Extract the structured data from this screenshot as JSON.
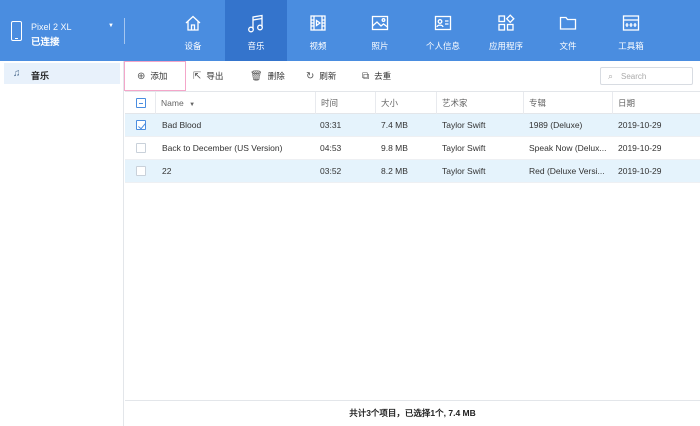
{
  "device": {
    "name": "Pixel 2 XL",
    "status": "已连接"
  },
  "nav": [
    {
      "id": "device",
      "label": "设备",
      "icon": "home-icon"
    },
    {
      "id": "music",
      "label": "音乐",
      "icon": "music-note-icon"
    },
    {
      "id": "video",
      "label": "视频",
      "icon": "film-icon"
    },
    {
      "id": "photos",
      "label": "照片",
      "icon": "image-icon"
    },
    {
      "id": "contacts",
      "label": "个人信息",
      "icon": "contact-card-icon"
    },
    {
      "id": "apps",
      "label": "应用程序",
      "icon": "apps-grid-icon"
    },
    {
      "id": "files",
      "label": "文件",
      "icon": "folder-icon"
    },
    {
      "id": "toolbox",
      "label": "工具箱",
      "icon": "toolbox-icon"
    }
  ],
  "sidebar": {
    "items": [
      {
        "label": "音乐",
        "icon": "music-note-icon"
      }
    ]
  },
  "toolbar": {
    "add": "添加",
    "export": "导出",
    "delete": "删除",
    "refresh": "刷新",
    "dedupe": "去重",
    "search_placeholder": "Search"
  },
  "table": {
    "columns": {
      "name": "Name",
      "time": "时间",
      "size": "大小",
      "artist": "艺术家",
      "album": "专辑",
      "date": "日期"
    },
    "rows": [
      {
        "name": "Bad Blood",
        "time": "03:31",
        "size": "7.4 MB",
        "artist": "Taylor Swift",
        "album": "1989 (Deluxe)",
        "date": "2019-10-29",
        "checked": true
      },
      {
        "name": "Back to December (US Version)",
        "time": "04:53",
        "size": "9.8 MB",
        "artist": "Taylor Swift",
        "album": "Speak Now (Delux...",
        "date": "2019-10-29",
        "checked": false
      },
      {
        "name": "22",
        "time": "03:52",
        "size": "8.2 MB",
        "artist": "Taylor Swift",
        "album": "Red (Deluxe Versi...",
        "date": "2019-10-29",
        "checked": false
      }
    ]
  },
  "footer": {
    "summary": "共计3个项目，已选择1个, 7.4 MB"
  },
  "colors": {
    "topbar": "#4a8de0",
    "active_tab": "#3474cc",
    "selected_row": "#e5f3fc",
    "add_highlight": "#f4a6c9"
  }
}
